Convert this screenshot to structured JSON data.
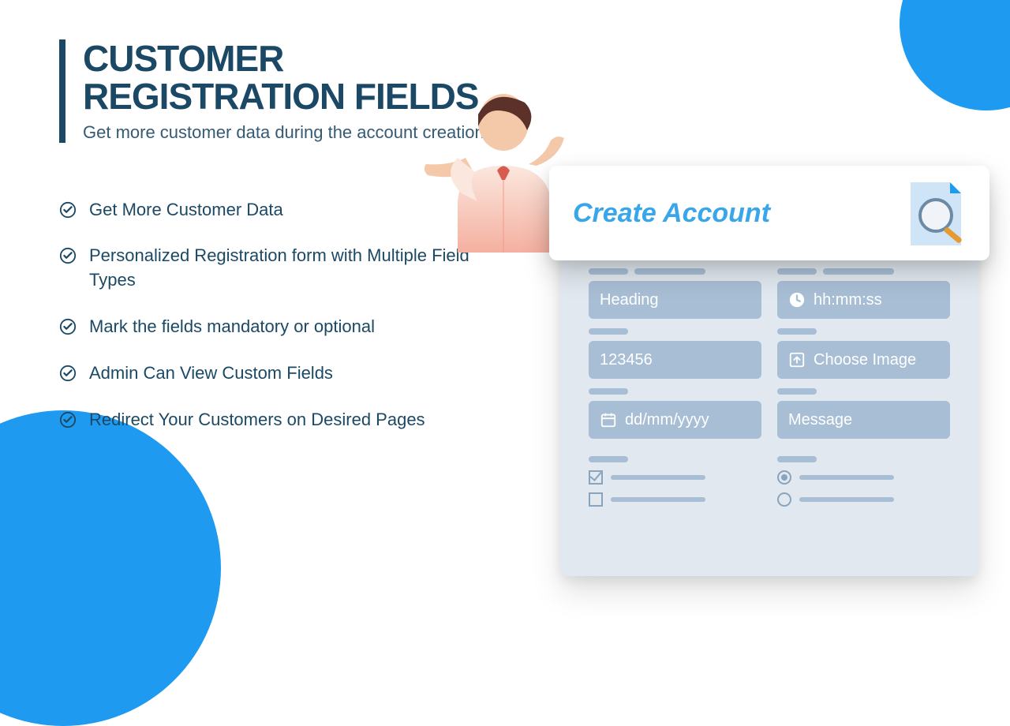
{
  "title": "CUSTOMER REGISTRATION FIELDS",
  "subtitle": "Get more customer data during the account creation",
  "bullets": [
    "Get More Customer Data",
    "Personalized Registration form with Multiple Field Types",
    "Mark the fields mandatory or optional",
    "Admin Can  View Custom Fields",
    "Redirect Your Customers on Desired Pages"
  ],
  "form": {
    "header": "Create Account",
    "fields": {
      "heading": "Heading",
      "time": "hh:mm:ss",
      "number": "123456",
      "image": "Choose Image",
      "date": "dd/mm/yyyy",
      "message": "Message"
    }
  }
}
